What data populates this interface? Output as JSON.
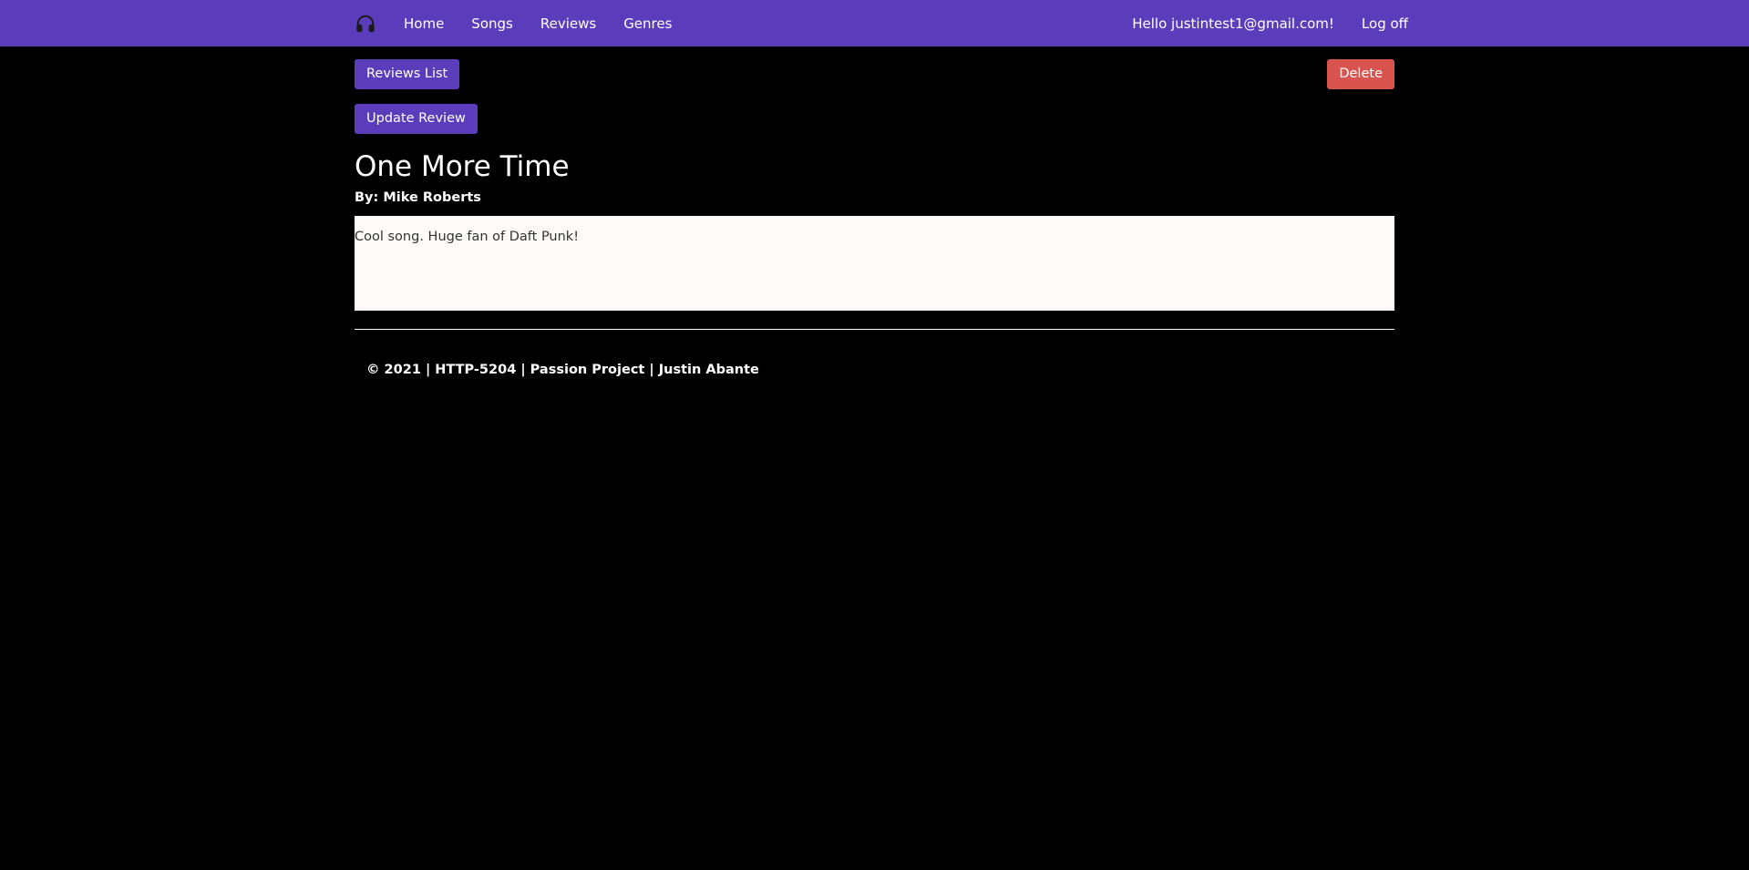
{
  "nav": {
    "brand_icon": "headphones-icon",
    "links": [
      "Home",
      "Songs",
      "Reviews",
      "Genres"
    ],
    "greeting": "Hello justintest1@gmail.com!",
    "logoff": "Log off",
    "color": "#5b3cba"
  },
  "actions": {
    "reviews_list": "Reviews List",
    "delete": "Delete",
    "update_review": "Update Review",
    "danger_color": "#d9534f"
  },
  "review": {
    "title": "One More Time",
    "author": "By: Mike Roberts",
    "body": "Cool song. Huge fan of Daft Punk!"
  },
  "footer": {
    "text": "© 2021 | HTTP-5204 | Passion Project | Justin Abante"
  }
}
